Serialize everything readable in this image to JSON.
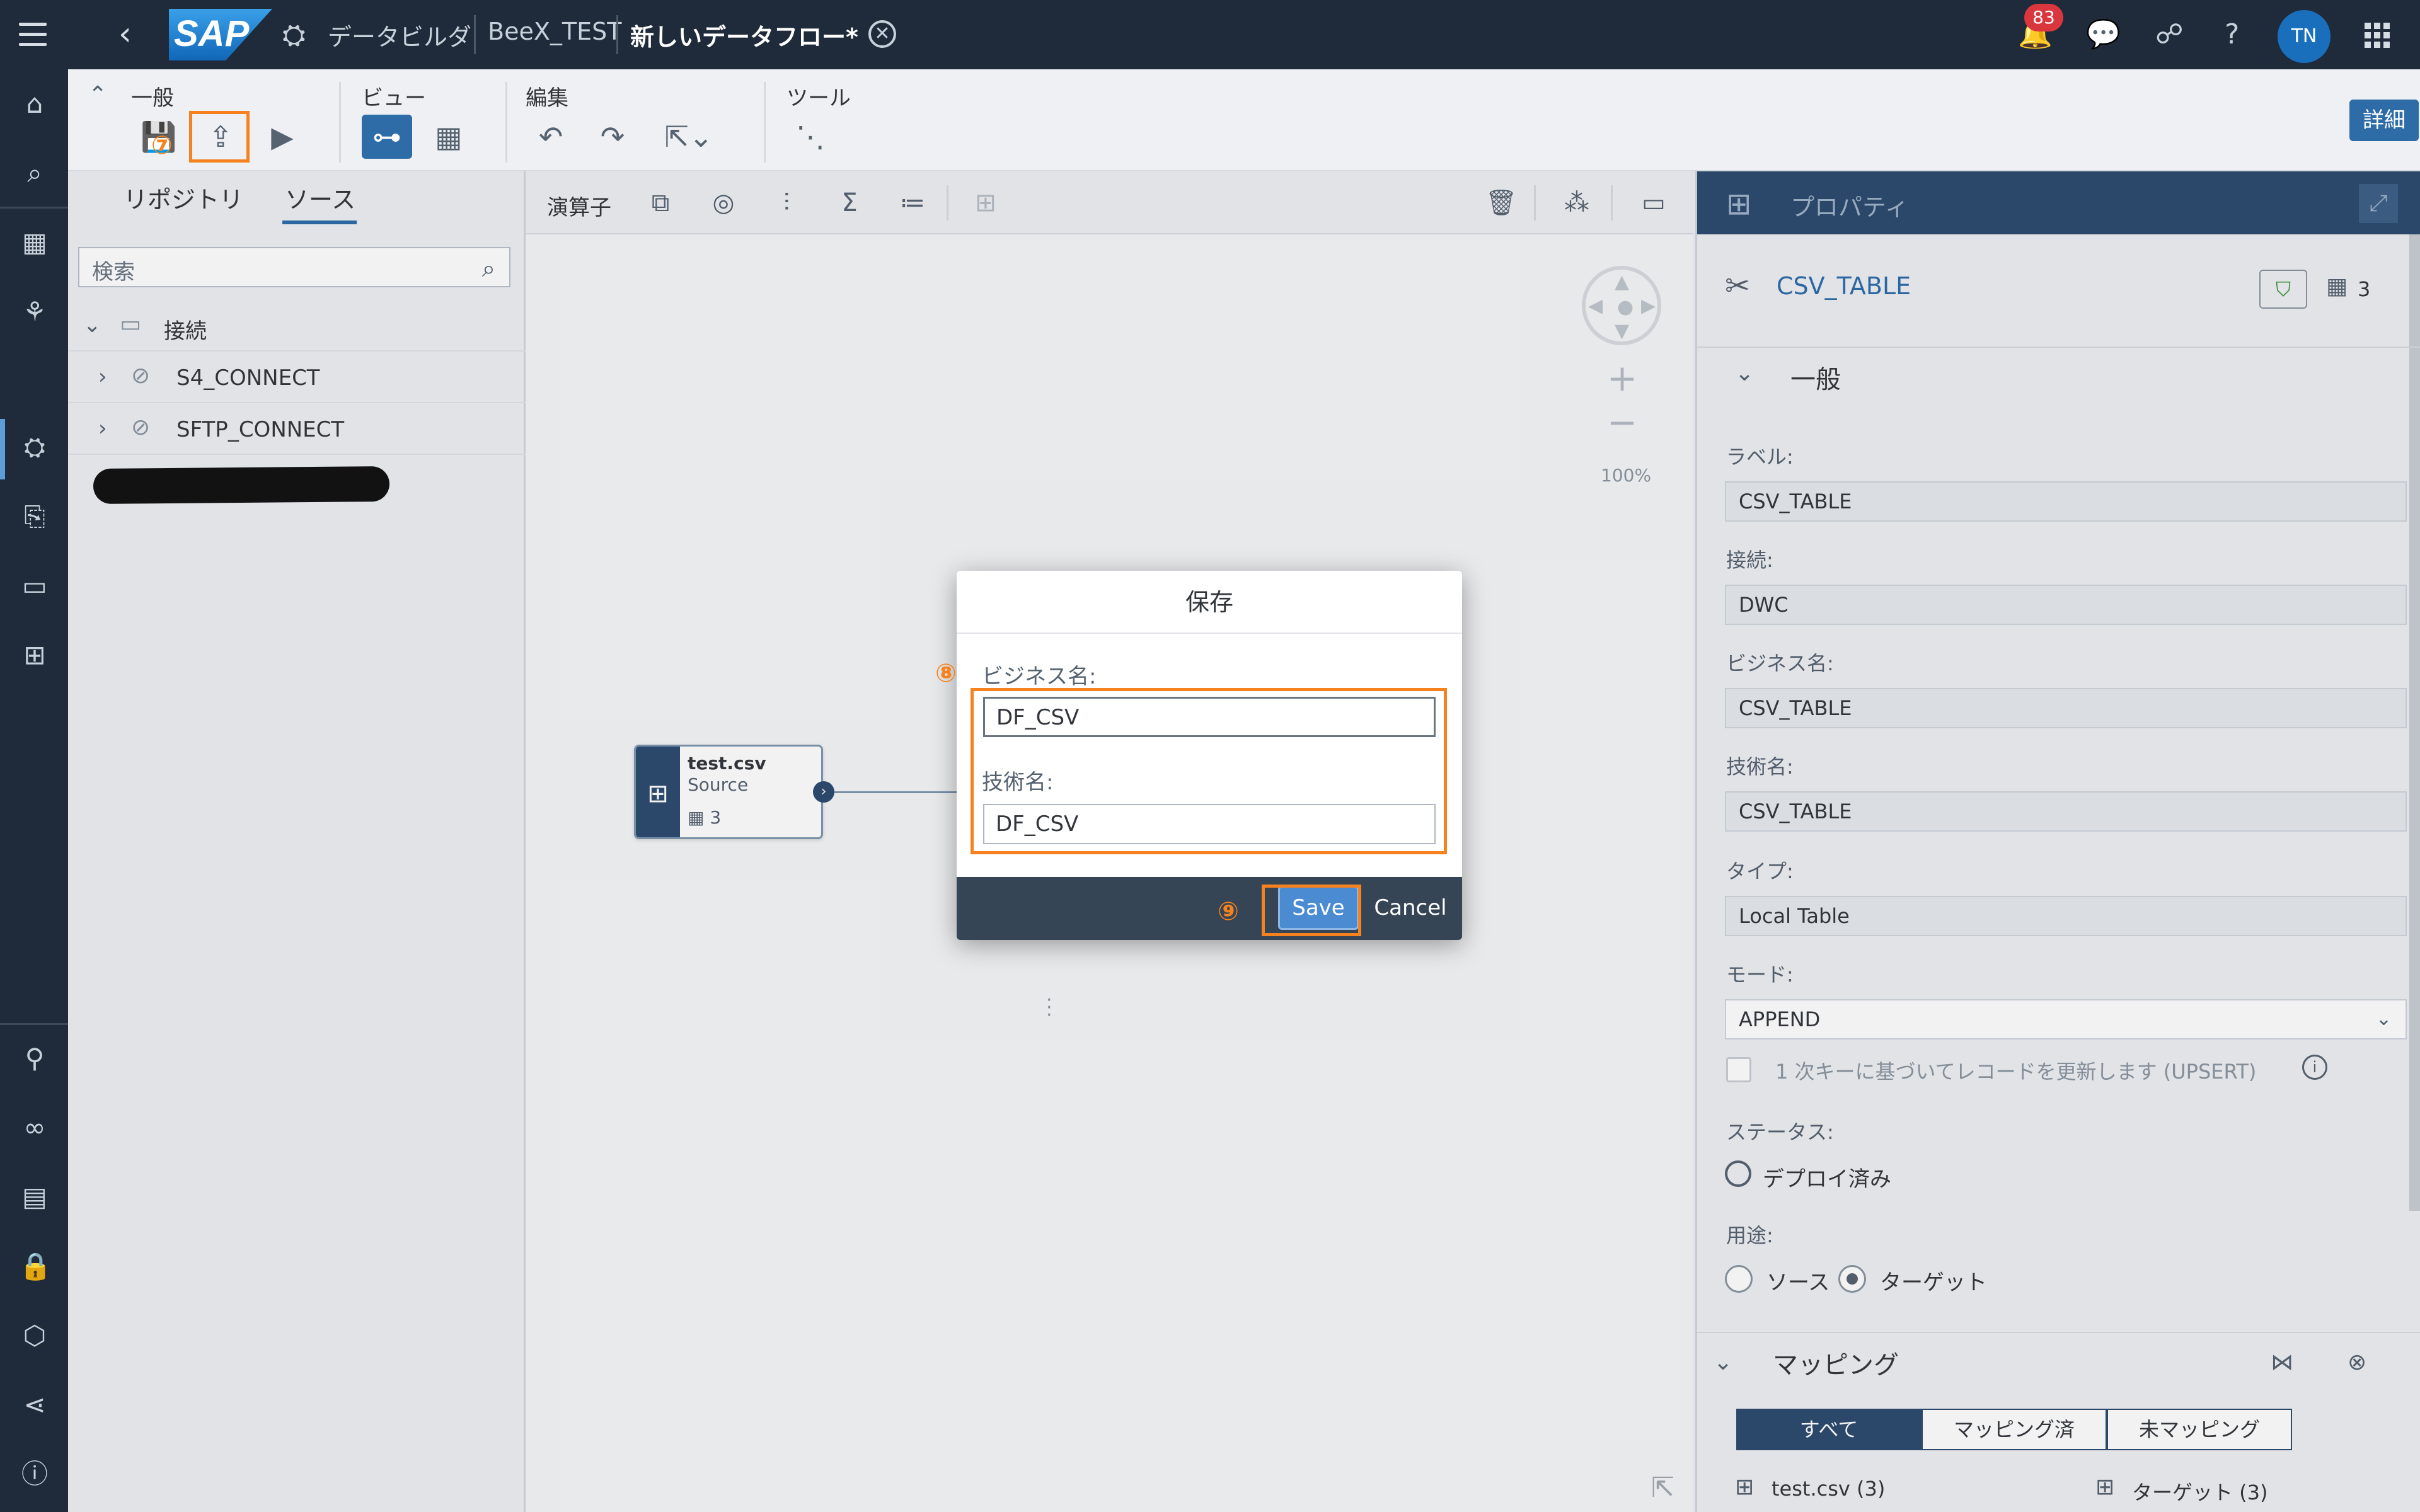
{
  "shell": {
    "crumb_app": "データビルダ",
    "crumb_space": "BeeX_TEST",
    "crumb_flow": "新しいデータフロー*",
    "notification_count": "83",
    "avatar_initials": "TN"
  },
  "toolbar": {
    "group_general": "一般",
    "group_view": "ビュー",
    "group_edit": "編集",
    "group_tools": "ツール",
    "detail_button": "詳細",
    "marker_deploy": "⑦"
  },
  "left_panel": {
    "tab_repository": "リポジトリ",
    "tab_source": "ソース",
    "search_placeholder": "検索",
    "tree": {
      "root_label": "接続",
      "items": [
        {
          "label": "S4_CONNECT"
        },
        {
          "label": "SFTP_CONNECT"
        }
      ]
    }
  },
  "canvas": {
    "toolbar_label": "演算子",
    "zoom_level": "100%",
    "node": {
      "name": "test.csv",
      "type": "Source",
      "column_count": "3"
    }
  },
  "dialog": {
    "title": "保存",
    "marker_fields": "⑧",
    "marker_save": "⑨",
    "business_name_label": "ビジネス名:",
    "business_name_value": "DF_CSV",
    "technical_name_label": "技術名:",
    "technical_name_value": "DF_CSV",
    "save_label": "Save",
    "cancel_label": "Cancel"
  },
  "properties": {
    "header_title": "プロパティ",
    "object_name": "CSV_TABLE",
    "column_count": "3",
    "section_general": "一般",
    "label_label": "ラベル:",
    "label_value": "CSV_TABLE",
    "connection_label": "接続:",
    "connection_value": "DWC",
    "business_name_label": "ビジネス名:",
    "business_name_value": "CSV_TABLE",
    "technical_name_label": "技術名:",
    "technical_name_value": "CSV_TABLE",
    "type_label": "タイプ:",
    "type_value": "Local Table",
    "mode_label": "モード:",
    "mode_value": "APPEND",
    "upsert_label": "1 次キーに基づいてレコードを更新します (UPSERT)",
    "status_label": "ステータス:",
    "status_value": "デプロイ済み",
    "usage_label": "用途:",
    "usage_source": "ソース",
    "usage_target": "ターゲット",
    "section_mapping": "マッピング",
    "mapping_tabs": [
      "すべて",
      "マッピング済",
      "未マッピング"
    ],
    "mapping_source": "test.csv (3)",
    "mapping_target": "ターゲット (3)"
  }
}
